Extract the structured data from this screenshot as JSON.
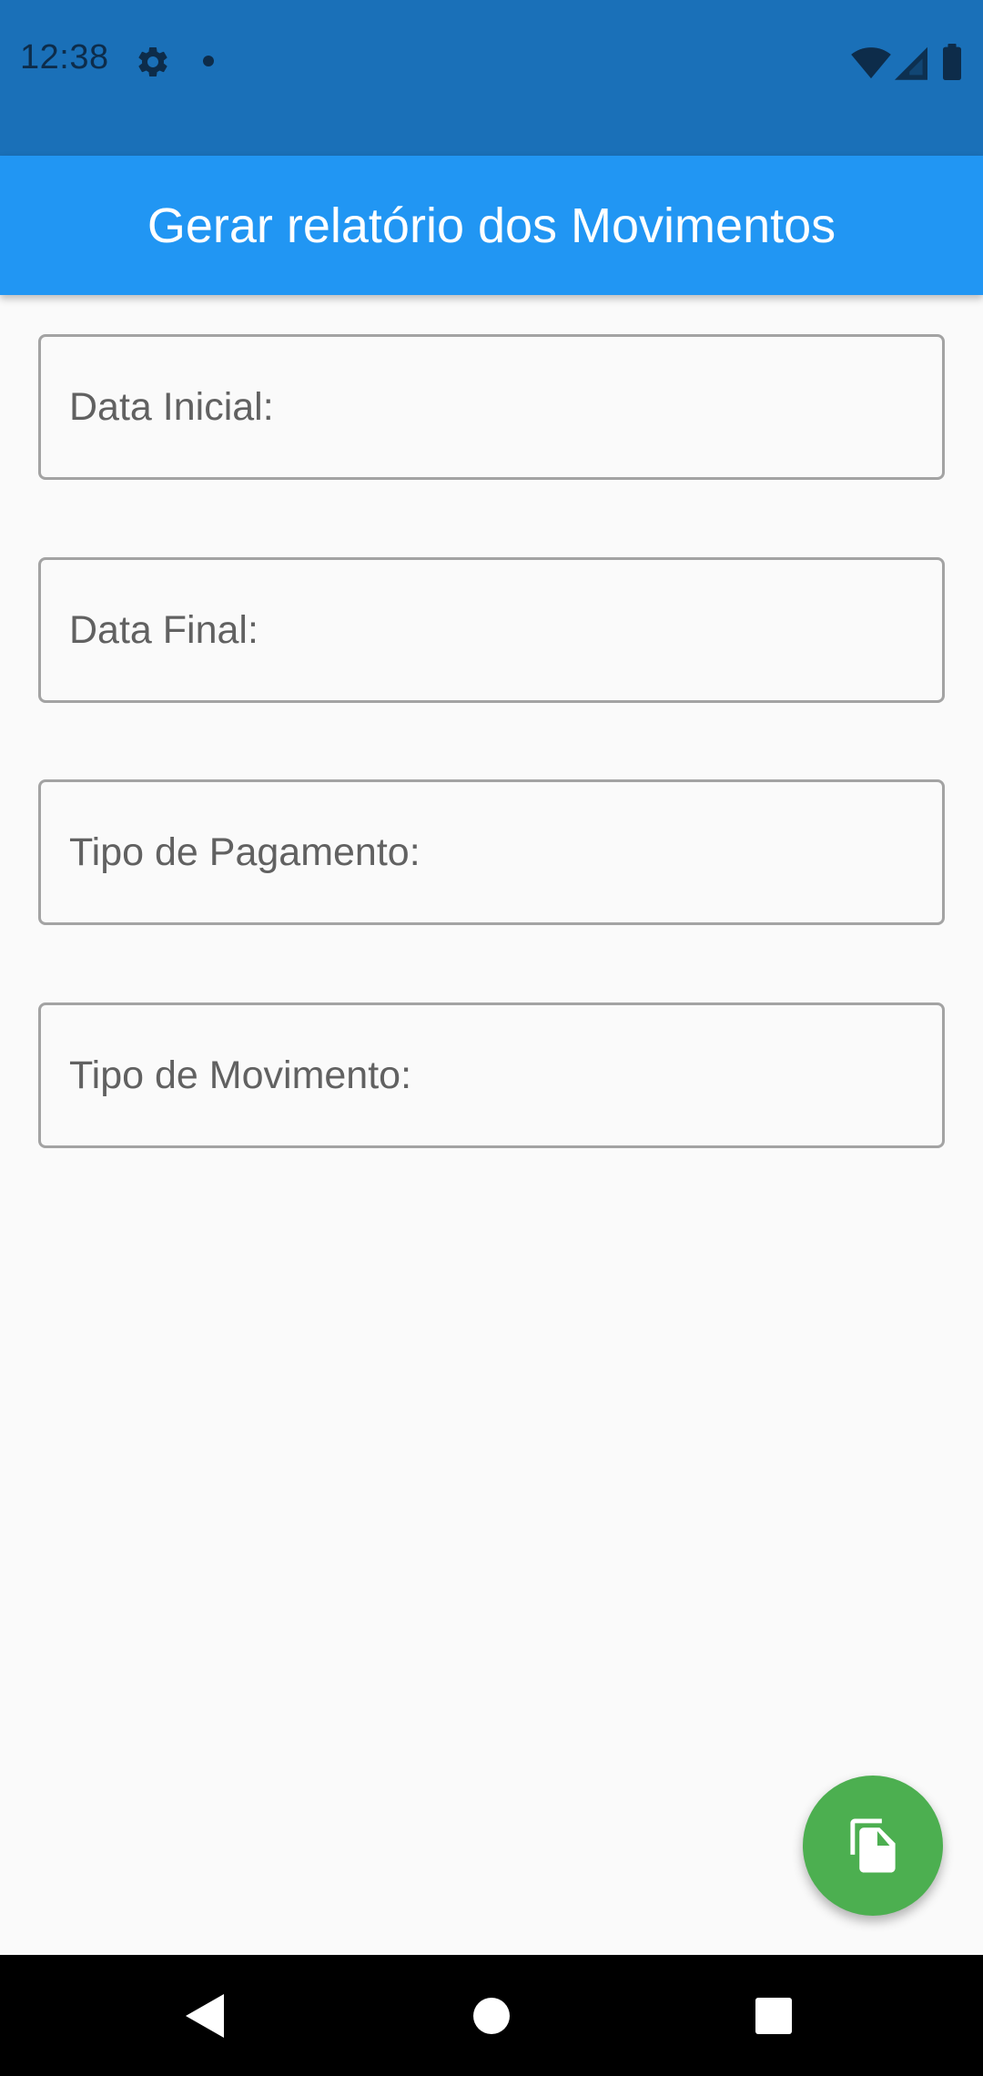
{
  "status_bar": {
    "time": "12:38",
    "background_color": "#1a70b8",
    "icons": [
      "gear-icon",
      "notification-dot-icon",
      "wifi-icon",
      "cell-signal-icon",
      "battery-icon"
    ]
  },
  "app_bar": {
    "title": "Gerar relatório dos Movimentos",
    "background_color": "#2196f3"
  },
  "form": {
    "fields": [
      {
        "label": "Data Inicial:",
        "value": ""
      },
      {
        "label": "Data Final:",
        "value": ""
      },
      {
        "label": "Tipo de Pagamento:",
        "value": ""
      },
      {
        "label": "Tipo de Movimento:",
        "value": ""
      }
    ]
  },
  "fab": {
    "icon": "copy-document-icon",
    "color": "#4caf50"
  },
  "nav_bar": {
    "buttons": [
      "back-icon",
      "home-icon",
      "recents-icon"
    ]
  }
}
